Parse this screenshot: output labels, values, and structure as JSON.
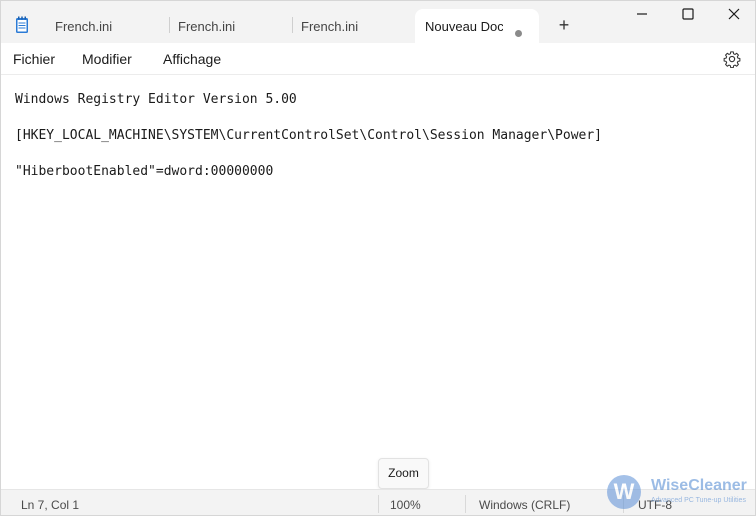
{
  "tabs": [
    {
      "label": "French.ini"
    },
    {
      "label": "French.ini"
    },
    {
      "label": "French.ini"
    },
    {
      "label": "Nouveau Docu",
      "active": true,
      "unsaved": true
    }
  ],
  "new_tab_glyph": "+",
  "menu": {
    "file": "Fichier",
    "edit": "Modifier",
    "view": "Affichage"
  },
  "editor": {
    "lines": [
      "Windows Registry Editor Version 5.00",
      "[HKEY_LOCAL_MACHINE\\SYSTEM\\CurrentControlSet\\Control\\Session Manager\\Power]",
      "\"HiberbootEnabled\"=dword:00000000"
    ]
  },
  "zoom_tooltip": "Zoom",
  "status": {
    "position": "Ln 7, Col 1",
    "zoom": "100%",
    "line_ending": "Windows (CRLF)",
    "encoding": "UTF-8"
  },
  "watermark": {
    "letter": "W",
    "name": "WiseCleaner",
    "tagline": "Advanced PC Tune-up Utilities"
  },
  "icons": {
    "app": "notepad-icon",
    "minimize": "minimize-icon",
    "maximize": "maximize-icon",
    "close": "close-icon",
    "settings": "gear-icon"
  },
  "colors": {
    "titlebar_bg": "#f3f3f3",
    "statusbar_bg": "#f3f3f3",
    "editor_bg": "#ffffff",
    "notepad_blue": "#2b7bd6"
  }
}
